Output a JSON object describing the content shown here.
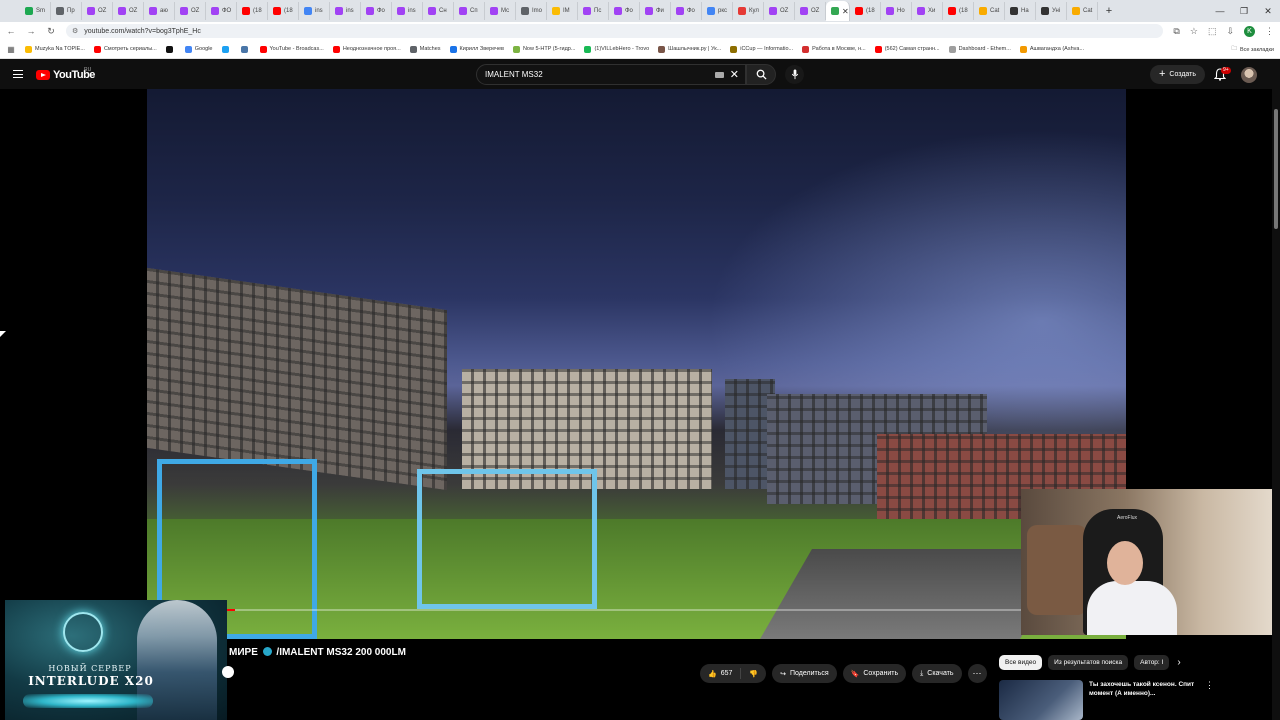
{
  "browser": {
    "tabs": [
      {
        "label": "Sm",
        "color": "#1da851"
      },
      {
        "label": "Пр",
        "color": "#5f6368"
      },
      {
        "label": "OZ",
        "color": "#a142f4"
      },
      {
        "label": "OZ",
        "color": "#a142f4"
      },
      {
        "label": "аю",
        "color": "#a142f4"
      },
      {
        "label": "OZ",
        "color": "#a142f4"
      },
      {
        "label": "ФО",
        "color": "#a142f4"
      },
      {
        "label": "(18",
        "color": "#ff0000"
      },
      {
        "label": "(18",
        "color": "#ff0000"
      },
      {
        "label": "ins",
        "color": "#4285f4"
      },
      {
        "label": "ins",
        "color": "#a142f4"
      },
      {
        "label": "Фо",
        "color": "#a142f4"
      },
      {
        "label": "ins",
        "color": "#a142f4"
      },
      {
        "label": "Сн",
        "color": "#a142f4"
      },
      {
        "label": "Сп",
        "color": "#a142f4"
      },
      {
        "label": "Мс",
        "color": "#a142f4"
      },
      {
        "label": "Imo",
        "color": "#5f6368"
      },
      {
        "label": "IM",
        "color": "#fbbc04"
      },
      {
        "label": "Пс",
        "color": "#a142f4"
      },
      {
        "label": "Фо",
        "color": "#a142f4"
      },
      {
        "label": "Фи",
        "color": "#a142f4"
      },
      {
        "label": "Фо",
        "color": "#a142f4"
      },
      {
        "label": "ркс",
        "color": "#4285f4"
      },
      {
        "label": "Кул",
        "color": "#e53935"
      },
      {
        "label": "OZ",
        "color": "#a142f4"
      },
      {
        "label": "OZ",
        "color": "#a142f4"
      }
    ],
    "active_tab": {
      "label": "",
      "color": "#34a853"
    },
    "tabs_after": [
      {
        "label": "(18",
        "color": "#ff0000"
      },
      {
        "label": "Но",
        "color": "#a142f4"
      },
      {
        "label": "Хи",
        "color": "#a142f4"
      },
      {
        "label": "(18",
        "color": "#ff0000"
      },
      {
        "label": "Cat",
        "color": "#f9ab00"
      },
      {
        "label": "На",
        "color": "#333333"
      },
      {
        "label": "Уні",
        "color": "#333333"
      },
      {
        "label": "Cat",
        "color": "#f9ab00"
      }
    ],
    "url": "youtube.com/watch?v=bog3TphE_Hc",
    "profile_initial": "K",
    "bookmarks": [
      {
        "label": "Muzyka Na TOPIE...",
        "color": "#fbbc04"
      },
      {
        "label": "Смотреть сериалы...",
        "color": "#ff0000"
      },
      {
        "label": "",
        "color": "#111111"
      },
      {
        "label": "Google",
        "color": "#4285f4"
      },
      {
        "label": "",
        "color": "#1da1f2"
      },
      {
        "label": "",
        "color": "#4a76a8"
      },
      {
        "label": "YouTube - Broadcas...",
        "color": "#ff0000"
      },
      {
        "label": "Неоднозначное проя...",
        "color": "#ff0000"
      },
      {
        "label": "Matches",
        "color": "#5f6368"
      },
      {
        "label": "Кирилл Зверечев",
        "color": "#1a73e8"
      },
      {
        "label": "Now 5-HTP (5-гидр...",
        "color": "#7cb342"
      },
      {
        "label": "(1)VILLebHero - Trovo",
        "color": "#19b955"
      },
      {
        "label": "Шашлычник.ру | Ук...",
        "color": "#795548"
      },
      {
        "label": "iCCup — Informatio...",
        "color": "#8d6e00"
      },
      {
        "label": "Работа в Москве, н...",
        "color": "#d32f2f"
      },
      {
        "label": "(562) Самая странн...",
        "color": "#ff0000"
      },
      {
        "label": "Dashboard - Ethem...",
        "color": "#9e9e9e"
      },
      {
        "label": "Ашвагандха (Ashva...",
        "color": "#f29900"
      }
    ],
    "all_bookmarks": "Все закладки"
  },
  "youtube": {
    "logo_text": "YouTube",
    "country": "RU",
    "search_value": "IMALENT MS32",
    "create_label": "Создать",
    "notif_badge": "9+",
    "video_title_prefix": "МИРЕ",
    "video_title": "/IMALENT MS32 200 000LM",
    "likes": "657",
    "share_label": "Поделиться",
    "save_label": "Сохранить",
    "download_label": "Скачать",
    "progress": 0.09,
    "chips": [
      "Все видео",
      "Из результатов поиска",
      "Автор: I"
    ],
    "rec_title": "Ты захочешь такой ксенон. Спит момент (А именно)..."
  },
  "ad": {
    "line1": "НОВЫЙ СЕРВЕР",
    "line2": "INTERLUDE X20"
  },
  "webcam": {
    "brand": "AeroFlux"
  }
}
